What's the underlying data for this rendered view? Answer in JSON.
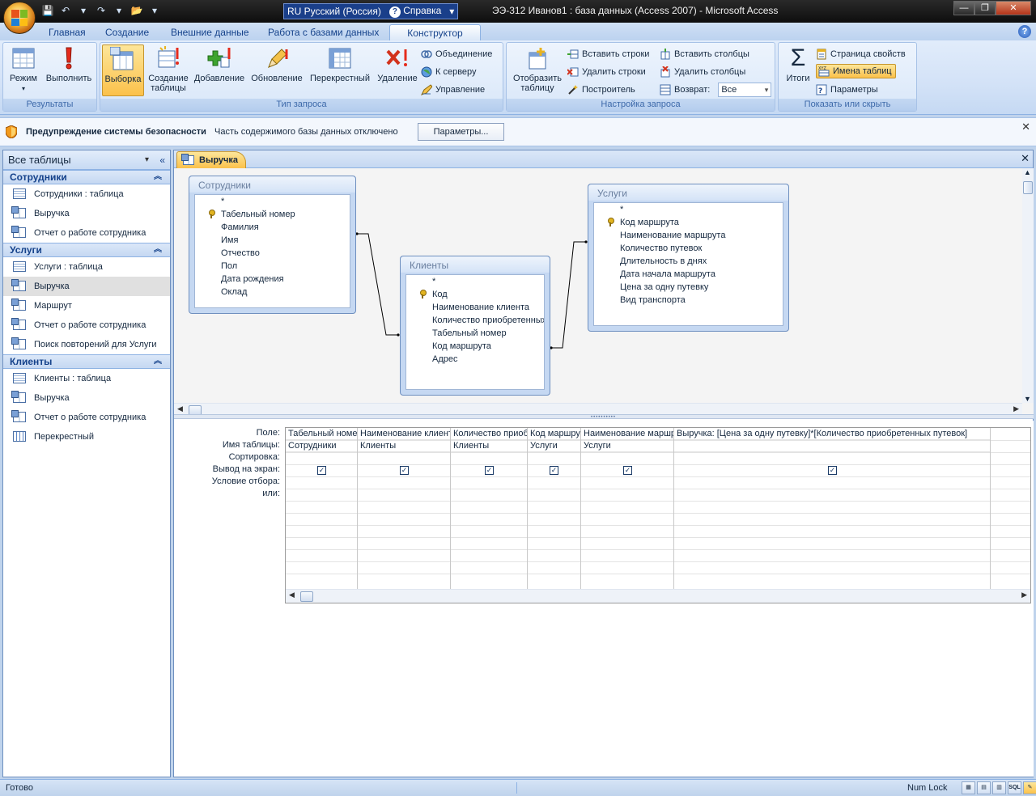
{
  "window": {
    "title": "ЭЭ-312 Иванов1 : база данных (Access 2007) - Microsoft Access",
    "language": "RU Русский (Россия)",
    "help": "Справка"
  },
  "tabs": [
    "Главная",
    "Создание",
    "Внешние данные",
    "Работа с базами данных",
    "Конструктор"
  ],
  "active_tab": "Конструктор",
  "ribbon": {
    "results": {
      "label": "Результаты",
      "mode": "Режим",
      "run": "Выполнить"
    },
    "query_type": {
      "label": "Тип запроса",
      "select": "Выборка",
      "make_table": "Создание таблицы",
      "append": "Добавление",
      "update": "Обновление",
      "crosstab": "Перекрестный",
      "delete": "Удаление",
      "union": "Объединение",
      "pass_through": "К серверу",
      "data_definition": "Управление"
    },
    "query_setup": {
      "label": "Настройка запроса",
      "show_table": "Отобразить таблицу",
      "insert_rows": "Вставить строки",
      "delete_rows": "Удалить строки",
      "builder": "Построитель",
      "insert_columns": "Вставить столбцы",
      "delete_columns": "Удалить столбцы",
      "return_label": "Возврат:",
      "return_value": "Все"
    },
    "show_hide": {
      "label": "Показать или скрыть",
      "totals": "Итоги",
      "property_sheet": "Страница свойств",
      "table_names": "Имена таблиц",
      "parameters": "Параметры"
    }
  },
  "security": {
    "title": "Предупреждение системы безопасности",
    "message": "Часть содержимого базы данных отключено",
    "button": "Параметры..."
  },
  "nav": {
    "header": "Все таблицы",
    "groups": [
      {
        "name": "Сотрудники",
        "items": [
          {
            "label": "Сотрудники : таблица",
            "icon": "table"
          },
          {
            "label": "Выручка",
            "icon": "query"
          },
          {
            "label": "Отчет о работе сотрудника",
            "icon": "query"
          }
        ]
      },
      {
        "name": "Услуги",
        "items": [
          {
            "label": "Услуги : таблица",
            "icon": "table"
          },
          {
            "label": "Выручка",
            "icon": "query",
            "selected": true
          },
          {
            "label": "Маршрут",
            "icon": "query"
          },
          {
            "label": "Отчет о работе сотрудника",
            "icon": "query"
          },
          {
            "label": "Поиск повторений для Услуги",
            "icon": "query"
          }
        ]
      },
      {
        "name": "Клиенты",
        "items": [
          {
            "label": "Клиенты : таблица",
            "icon": "table"
          },
          {
            "label": "Выручка",
            "icon": "query"
          },
          {
            "label": "Отчет о работе сотрудника",
            "icon": "query"
          },
          {
            "label": "Перекрестный",
            "icon": "crosstab"
          }
        ]
      }
    ]
  },
  "document": {
    "tab": "Выручка",
    "tables": {
      "employees": {
        "title": "Сотрудники",
        "fields": [
          "*",
          "Табельный номер",
          "Фамилия",
          "Имя",
          "Отчество",
          "Пол",
          "Дата рождения",
          "Оклад"
        ],
        "key": 1
      },
      "clients": {
        "title": "Клиенты",
        "fields": [
          "*",
          "Код",
          "Наименование клиента",
          "Количество приобретенных путевок",
          "Табельный номер",
          "Код маршрута",
          "Адрес"
        ],
        "key": 1
      },
      "services": {
        "title": "Услуги",
        "fields": [
          "*",
          "Код маршрута",
          "Наименование маршрута",
          "Количество путевок",
          "Длительность в днях",
          "Дата начала маршрута",
          "Цена за одну путевку",
          "Вид транспорта"
        ],
        "key": 1
      }
    },
    "grid": {
      "row_labels": [
        "Поле:",
        "Имя таблицы:",
        "Сортировка:",
        "Вывод на экран:",
        "Условие отбора:",
        "или:"
      ],
      "columns": [
        {
          "field": "Табельный номер",
          "table": "Сотрудники",
          "show": true
        },
        {
          "field": "Наименование клиента",
          "table": "Клиенты",
          "show": true
        },
        {
          "field": "Количество приобретенных путевок",
          "table": "Клиенты",
          "show": true
        },
        {
          "field": "Код маршрута",
          "table": "Услуги",
          "show": true
        },
        {
          "field": "Наименование маршрута",
          "table": "Услуги",
          "show": true
        },
        {
          "field": "Выручка: [Цена за одну путевку]*[Количество приобретенных путевок]",
          "table": "",
          "show": true
        }
      ]
    }
  },
  "status": {
    "ready": "Готово",
    "numlock": "Num Lock",
    "sql": "SQL"
  }
}
